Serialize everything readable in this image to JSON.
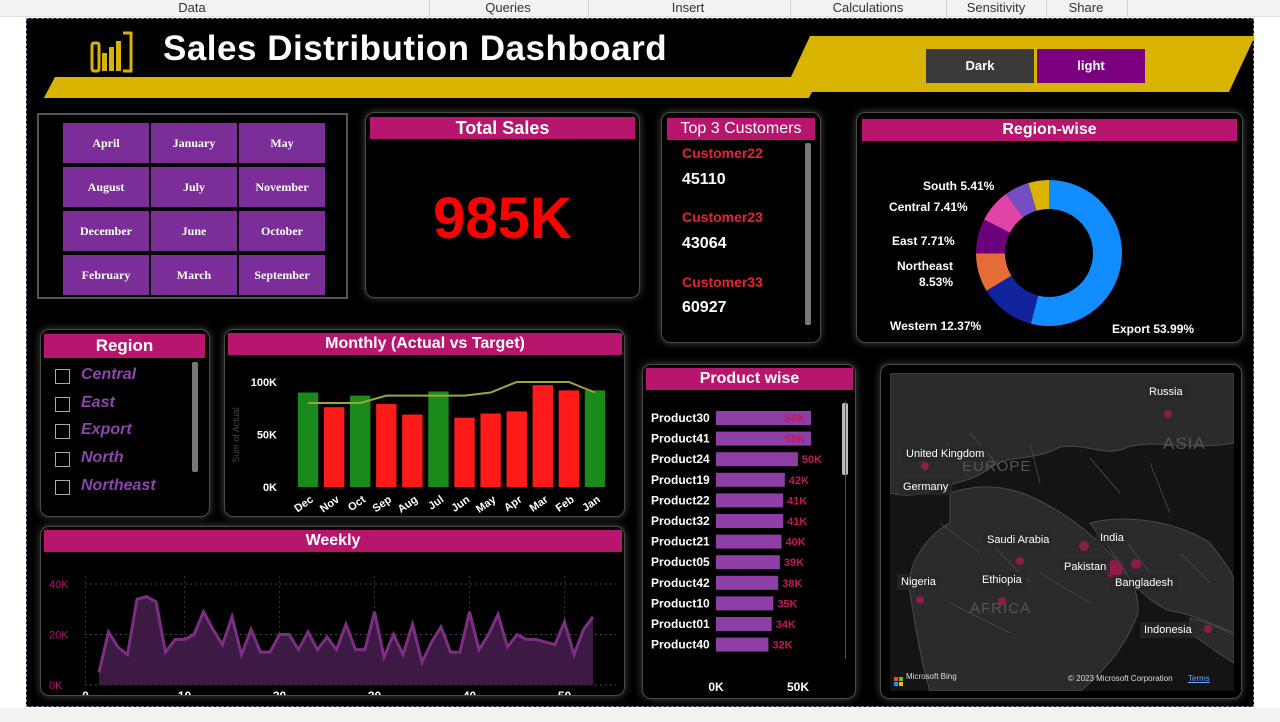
{
  "ribbon": {
    "tabs": [
      "Data",
      "Queries",
      "Insert",
      "Calculations",
      "Sensitivity",
      "Share"
    ]
  },
  "header": {
    "title": "Sales Distribution Dashboard",
    "theme_buttons": [
      "Dark",
      "light"
    ],
    "accent": "#d8b300"
  },
  "months": {
    "items": [
      "April",
      "January",
      "May",
      "August",
      "July",
      "November",
      "December",
      "June",
      "October",
      "February",
      "March",
      "September"
    ]
  },
  "total_sales": {
    "title": "Total Sales",
    "value": "985K",
    "value_color": "#ff0000"
  },
  "top_customers": {
    "title": "Top 3 Customers",
    "items": [
      {
        "name": "Customer22",
        "value": "45110"
      },
      {
        "name": "Customer23",
        "value": "43064"
      },
      {
        "name": "Customer33",
        "value": "60927"
      }
    ]
  },
  "region_slicer": {
    "title": "Region",
    "items": [
      "Central",
      "East",
      "Export",
      "North",
      "Northeast"
    ]
  },
  "region_wise": {
    "title": "Region-wise"
  },
  "monthly": {
    "title": "Monthly (Actual vs Target)"
  },
  "weekly": {
    "title": "Weekly"
  },
  "product_wise": {
    "title": "Product wise"
  },
  "map": {
    "labels": [
      "Russia",
      "United Kingdom",
      "Germany",
      "Saudi Arabia",
      "India",
      "Pakistan",
      "Bangladesh",
      "Nigeria",
      "Ethiopia",
      "Indonesia"
    ],
    "watermarks": [
      "EUROPE",
      "ASIA",
      "AFRICA"
    ],
    "bing_label": "Microsoft Bing",
    "copyright": "© 2023 Microsoft Corporation",
    "terms": "Terms"
  },
  "chart_data": [
    {
      "type": "pie",
      "title": "Region-wise",
      "slices": [
        {
          "label": "Export",
          "pct": 53.99,
          "color": "#118dff"
        },
        {
          "label": "Western",
          "pct": 12.37,
          "color": "#12239e"
        },
        {
          "label": "Northeast",
          "pct": 8.53,
          "color": "#e66c37"
        },
        {
          "label": "East",
          "pct": 7.71,
          "color": "#6b007b"
        },
        {
          "label": "Central",
          "pct": 7.41,
          "color": "#e044a7"
        },
        {
          "label": "South",
          "pct": 5.41,
          "color": "#744ec2"
        },
        {
          "label": "",
          "pct": 4.58,
          "color": "#d9b300"
        }
      ],
      "display_labels": [
        "Export 53.99%",
        "Western 12.37%",
        "Northeast 8.53%",
        "East 7.71%",
        "Central 7.41%",
        "South 5.41%"
      ]
    },
    {
      "type": "bar",
      "title": "Monthly (Actual vs Target)",
      "categories": [
        "Dec",
        "Nov",
        "Oct",
        "Sep",
        "Aug",
        "Jul",
        "Jun",
        "May",
        "Apr",
        "Mar",
        "Feb",
        "Jan"
      ],
      "series": [
        {
          "values": [
            90000,
            76000,
            87000,
            79000,
            69000,
            91000,
            66000,
            70000,
            72000,
            97000,
            92000,
            92000
          ],
          "colors": [
            "#1a8a1a",
            "#ff1a1a",
            "#1a8a1a",
            "#ff1a1a",
            "#ff1a1a",
            "#1a8a1a",
            "#ff1a1a",
            "#ff1a1a",
            "#ff1a1a",
            "#ff1a1a",
            "#ff1a1a",
            "#1a8a1a"
          ]
        },
        {
          "values": [
            80000,
            80000,
            80000,
            87000,
            87000,
            87000,
            87000,
            90000,
            100000,
            100000,
            100000,
            90000
          ],
          "color": "#9aa83a"
        }
      ],
      "ylim": [
        0,
        100000
      ],
      "yticks": [
        "0K",
        "50K",
        "100K"
      ],
      "ylabel": "Sum of Actual"
    },
    {
      "type": "area",
      "title": "Weekly",
      "x": [
        1,
        2,
        3,
        4,
        5,
        6,
        7,
        8,
        9,
        10,
        11,
        12,
        13,
        14,
        15,
        16,
        17,
        18,
        19,
        20,
        21,
        22,
        23,
        24,
        25,
        26,
        27,
        28,
        29,
        30,
        31,
        32,
        33,
        34,
        35,
        36,
        37,
        38,
        39,
        40,
        41,
        42,
        43,
        44,
        45,
        46,
        47,
        48,
        49,
        50,
        51,
        52,
        53
      ],
      "values": [
        5000,
        21000,
        15000,
        12000,
        34000,
        35000,
        33000,
        13000,
        18000,
        18000,
        20000,
        29000,
        22000,
        16000,
        27000,
        12000,
        22000,
        13000,
        13000,
        20000,
        20000,
        14000,
        21000,
        14000,
        19000,
        14000,
        24000,
        14000,
        14000,
        29000,
        11000,
        20000,
        12000,
        24000,
        9000,
        17000,
        23000,
        13000,
        13000,
        29000,
        14000,
        20000,
        28000,
        15000,
        20000,
        18000,
        18000,
        17000,
        16000,
        25000,
        12000,
        22000,
        27000
      ],
      "color": "#7b2e82",
      "ylim": [
        0,
        40000
      ],
      "yticks": [
        "0K",
        "20K",
        "40K"
      ],
      "xticks": [
        "0",
        "10",
        "20",
        "30",
        "40",
        "50"
      ]
    },
    {
      "type": "bar",
      "orientation": "horizontal",
      "title": "Product wise",
      "categories": [
        "Product30",
        "Product41",
        "Product24",
        "Product19",
        "Product22",
        "Product32",
        "Product21",
        "Product05",
        "Product42",
        "Product10",
        "Product01",
        "Product40"
      ],
      "values": [
        58000,
        58000,
        50000,
        42000,
        41000,
        41000,
        40000,
        39000,
        38000,
        35000,
        34000,
        32000
      ],
      "labels": [
        "58K",
        "58K",
        "50K",
        "42K",
        "41K",
        "41K",
        "40K",
        "39K",
        "38K",
        "35K",
        "34K",
        "32K"
      ],
      "color": "#8e3fa5",
      "label_color": "#c2185b",
      "xticks": [
        "0K",
        "50K"
      ],
      "xlim": [
        0,
        60000
      ]
    }
  ]
}
